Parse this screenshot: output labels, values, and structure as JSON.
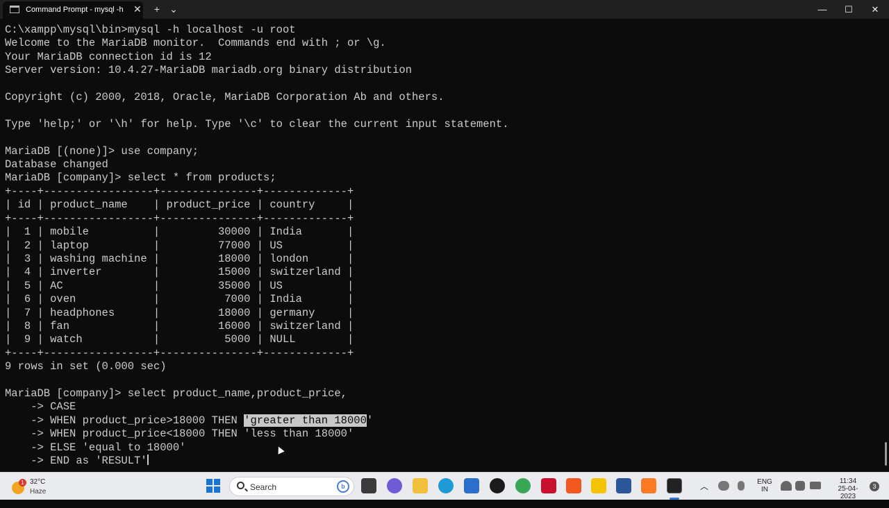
{
  "window": {
    "tab_title": "Command Prompt - mysql  -h",
    "tab_close": "✕",
    "new_tab": "+",
    "dropdown": "⌄",
    "minimize": "—",
    "maximize": "☐",
    "close": "✕"
  },
  "terminal": {
    "lines": [
      "C:\\xampp\\mysql\\bin>mysql -h localhost -u root",
      "Welcome to the MariaDB monitor.  Commands end with ; or \\g.",
      "Your MariaDB connection id is 12",
      "Server version: 10.4.27-MariaDB mariadb.org binary distribution",
      "",
      "Copyright (c) 2000, 2018, Oracle, MariaDB Corporation Ab and others.",
      "",
      "Type 'help;' or '\\h' for help. Type '\\c' to clear the current input statement.",
      "",
      "MariaDB [(none)]> use company;",
      "Database changed",
      "MariaDB [company]> select * from products;",
      "+----+-----------------+---------------+-------------+",
      "| id | product_name    | product_price | country     |",
      "+----+-----------------+---------------+-------------+",
      "|  1 | mobile          |         30000 | India       |",
      "|  2 | laptop          |         77000 | US          |",
      "|  3 | washing machine |         18000 | london      |",
      "|  4 | inverter        |         15000 | switzerland |",
      "|  5 | AC              |         35000 | US          |",
      "|  6 | oven            |          7000 | India       |",
      "|  7 | headphones      |         18000 | germany     |",
      "|  8 | fan             |         16000 | switzerland |",
      "|  9 | watch           |          5000 | NULL        |",
      "+----+-----------------+---------------+-------------+",
      "9 rows in set (0.000 sec)",
      "",
      "MariaDB [company]> select product_name,product_price,",
      "    -> CASE"
    ],
    "hl_line": {
      "before": "    -> WHEN product_price>18000 THEN ",
      "highlight": "'greater than 18000",
      "after": "'"
    },
    "tail_lines": [
      "    -> WHEN product_price<18000 THEN 'less than 18000'",
      "    -> ELSE 'equal to 18000'"
    ],
    "last_line": "    -> END as 'RESULT'"
  },
  "taskbar": {
    "weather_temp": "32°C",
    "weather_condition": "Haze",
    "weather_badge": "1",
    "search_placeholder": "Search",
    "search_badge": "b",
    "language_line1": "ENG",
    "language_line2": "IN",
    "time": "11:34",
    "date": "25-04-2023",
    "notification_count": "3",
    "tray_chevron": "︿"
  }
}
